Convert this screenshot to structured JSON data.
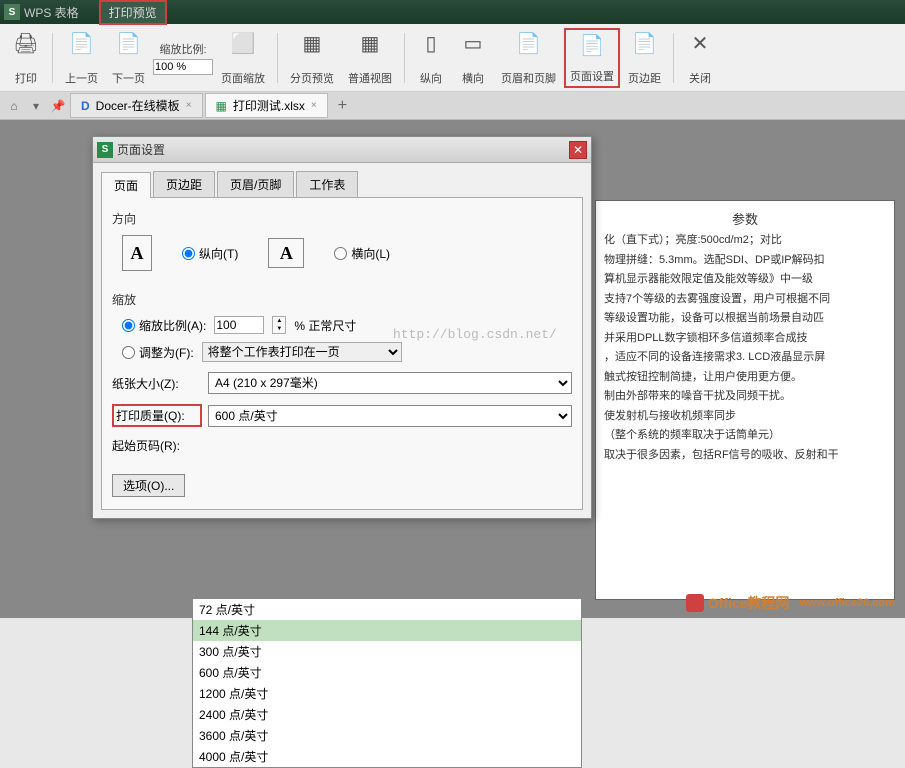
{
  "titlebar": {
    "app_name": "WPS 表格",
    "print_preview": "打印预览"
  },
  "ribbon": {
    "print": "打印",
    "prev_page": "上一页",
    "next_page": "下一页",
    "zoom_ratio_label": "缩放比例:",
    "zoom_value": "100 %",
    "page_zoom": "页面缩放",
    "page_break": "分页预览",
    "normal_view": "普通视图",
    "portrait": "纵向",
    "landscape": "横向",
    "header_footer": "页眉和页脚",
    "page_setup": "页面设置",
    "margins": "页边距",
    "close": "关闭"
  },
  "tabs": {
    "docer": "Docer-在线模板",
    "file": "打印测试.xlsx"
  },
  "dialog": {
    "title": "页面设置",
    "tab_page": "页面",
    "tab_margins": "页边距",
    "tab_header": "页眉/页脚",
    "tab_sheet": "工作表",
    "orientation_label": "方向",
    "portrait": "纵向(T)",
    "landscape": "横向(L)",
    "zoom_label": "缩放",
    "zoom_ratio": "缩放比例(A):",
    "zoom_value": "100",
    "normal_size": "% 正常尺寸",
    "fit_to": "调整为(F):",
    "fit_value": "将整个工作表打印在一页",
    "paper_size_label": "纸张大小(Z):",
    "paper_size_value": "A4 (210 x 297毫米)",
    "print_quality_label": "打印质量(Q):",
    "print_quality_value": "600 点/英寸",
    "start_page_label": "起始页码(R):",
    "options_btn": "选项(O)...",
    "dpi_options": [
      "72 点/英寸",
      "144 点/英寸",
      "300 点/英寸",
      "600 点/英寸",
      "1200 点/英寸",
      "2400 点/英寸",
      "3600 点/英寸",
      "4000 点/英寸"
    ]
  },
  "watermark": "http://blog.csdn.net/",
  "content": {
    "param_title": "参数",
    "line1": "化（直下式）；亮度:500cd/m2；对比",
    "line2": "物理拼缝：5.3mm。选配SDI、DP或IP解码扣",
    "line3": "算机显示器能效限定值及能效等级》中一级",
    "line4": "支持7个等级的去雾强度设置，用户可根据不同",
    "line5": "等级设置功能，设备可以根据当前场景自动匹",
    "line6": "并采用DPLL数字锁相环多信道频率合成技",
    "line7": "，适应不同的设备连接需求3. LCD液晶显示屏",
    "line8": "触式按钮控制简捷，让用户使用更方便。",
    "line9": "制由外部带来的噪音干扰及同频干扰。",
    "line10": "使发射机与接收机频率同步",
    "line11": "（整个系统的频率取决于话筒单元）",
    "line12": "取决于很多因素，包括RF信号的吸收、反射和干"
  },
  "footer": {
    "brand": "Office教程网",
    "url": "www.office26.com"
  }
}
